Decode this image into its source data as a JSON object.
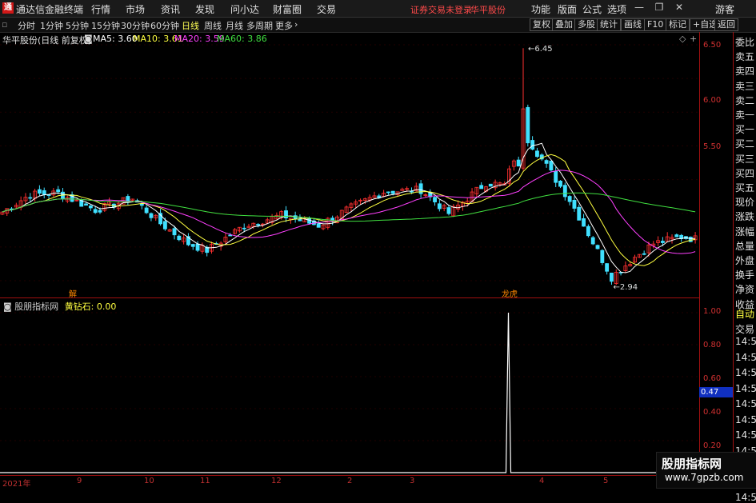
{
  "app": {
    "title": "通达信金融终端",
    "logo": "logo-icon"
  },
  "menu": [
    "行情",
    "市场",
    "资讯",
    "发现",
    "问小达",
    "财富圈",
    "交易"
  ],
  "notice": "证券交易未登录",
  "stock_name_top": "华平股份",
  "top_right_menu": [
    "功能",
    "版面",
    "公式",
    "选项"
  ],
  "guest": "游客",
  "periods": [
    "分时",
    "1分钟",
    "5分钟",
    "15分钟",
    "30分钟",
    "60分钟",
    "日线",
    "周线",
    "月线",
    "多周期",
    "更多"
  ],
  "active_period": "日线",
  "toolbar_right": [
    "复权",
    "叠加",
    "多股",
    "统计",
    "画线",
    "F10",
    "标记",
    "+自选",
    "返回"
  ],
  "info": {
    "title": "华平股份(日线 前复权)",
    "ma5": "MA5: 3.60",
    "ma10": "MA10: 3.61",
    "ma20": "MA20: 3.59",
    "ma60": "MA60: 3.86"
  },
  "price_axis": [
    "6.50",
    "6.00",
    "5.50",
    "5.00",
    "4.50",
    "4.00",
    "3.50",
    "3.00"
  ],
  "indicator": {
    "name": "股朋指标网",
    "label": "黄钻石: 0.00"
  },
  "ind_axis": [
    "1.00",
    "0.80",
    "0.60",
    "0.40",
    "0.20"
  ],
  "ind_highlight": "0.47",
  "right_panel": [
    "委比",
    "卖五",
    "卖四",
    "卖三",
    "卖二",
    "卖一",
    "买一",
    "买二",
    "买三",
    "买四",
    "买五",
    "现价",
    "涨跌",
    "涨幅",
    "总量",
    "外盘",
    "换手",
    "净资",
    "收益",
    "自动",
    "交易",
    "14:56",
    "14:56",
    "14:56",
    "14:56",
    "14:56",
    "14:56",
    "14:56",
    "14:56",
    "14:56",
    "14:56",
    "14:56"
  ],
  "x_labels": [
    "2021年",
    "9",
    "10",
    "11",
    "12",
    "2",
    "3",
    "4",
    "5"
  ],
  "annotations": {
    "high": "6.45",
    "low": "2.94",
    "mark1": "解",
    "mark2": "龙虎"
  },
  "watermark": {
    "line1": "股朋指标网",
    "line2": "www.7gpzb.com"
  },
  "colors": {
    "up": "#ff3030",
    "down": "#40e0ff",
    "ma5": "#ffffff",
    "ma10": "#ffff40",
    "ma20": "#ff40ff",
    "ma60": "#40e040",
    "axis": "#a01010"
  }
}
